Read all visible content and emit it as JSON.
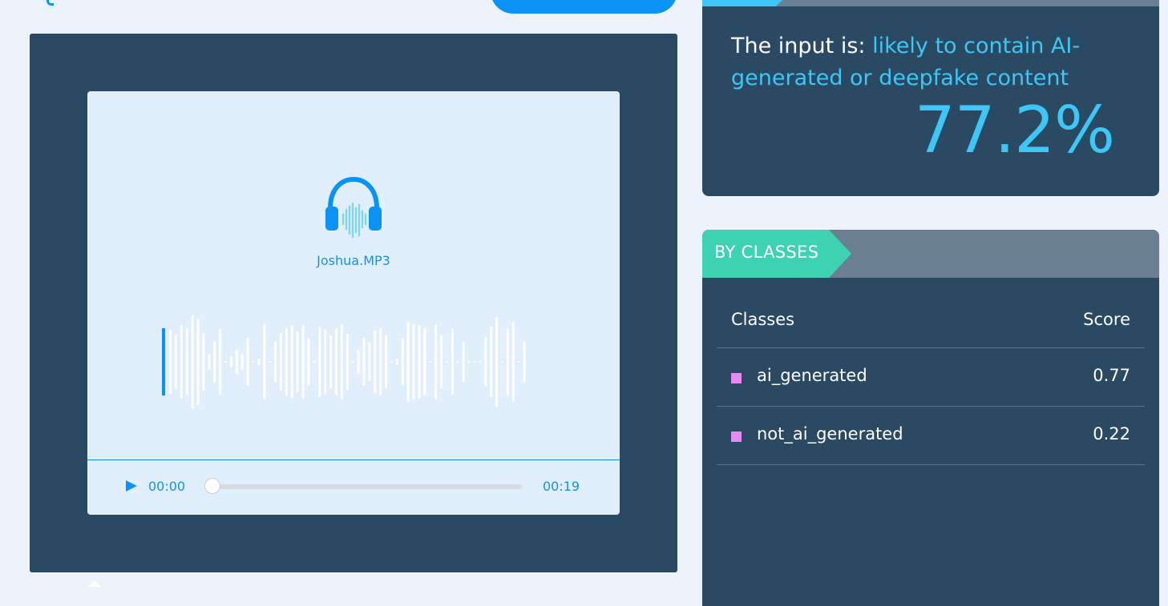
{
  "player": {
    "filename": "Joshua.MP3",
    "current_time": "00:00",
    "total_time": "00:19",
    "progress": 0,
    "waveform": [
      80,
      68,
      92,
      84,
      118,
      108,
      72,
      20,
      52,
      82,
      2,
      14,
      30,
      20,
      60,
      2,
      8,
      94,
      2,
      52,
      72,
      84,
      90,
      76,
      92,
      60,
      2,
      88,
      82,
      66,
      84,
      94,
      70,
      2,
      30,
      60,
      48,
      78,
      84,
      66,
      2,
      8,
      58,
      100,
      94,
      92,
      84,
      2,
      94,
      66,
      2,
      82,
      2,
      50,
      2,
      2,
      2,
      62,
      88,
      112,
      2,
      84,
      100,
      2,
      52,
      2,
      20
    ],
    "accent_color": "#0a93f5"
  },
  "result": {
    "label": "The input is:",
    "verdict": "likely to contain AI-generated or deepfake content",
    "percent": "77.2%",
    "accent_color": "#3ec6f7"
  },
  "classes": {
    "tab_label": "BY CLASSES",
    "header_class": "Classes",
    "header_score": "Score",
    "rows": [
      {
        "name": "ai_generated",
        "score": "0.77"
      },
      {
        "name": "not_ai_generated",
        "score": "0.22"
      }
    ],
    "swatch_color": "#e58af0"
  }
}
